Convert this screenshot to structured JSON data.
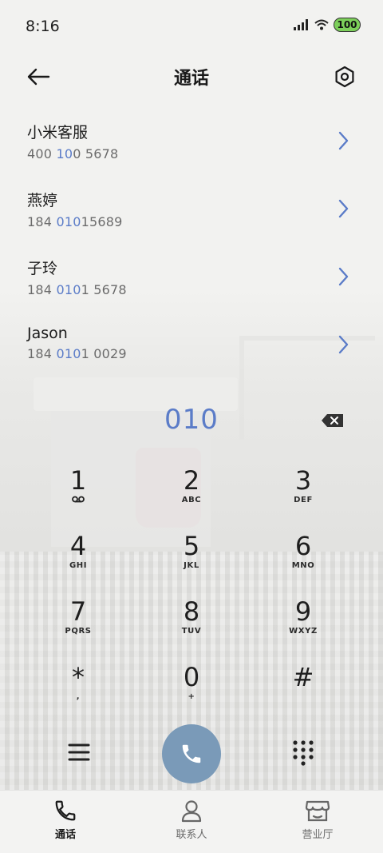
{
  "status_bar": {
    "time": "8:16",
    "battery": "100",
    "icons": [
      "signal-icon",
      "wifi-icon",
      "battery-icon"
    ]
  },
  "header": {
    "title": "通话",
    "back_icon": "arrow-left-icon",
    "settings_icon": "settings-hexagon-icon"
  },
  "results": [
    {
      "name": "小米客服",
      "num_a": "400 ",
      "num_hl1": "10",
      "num_b": "0 ",
      "num_hl2": "",
      "num_c": "5678"
    },
    {
      "name": "燕婷",
      "num_a": "184 ",
      "num_hl1": "010",
      "num_b": "15689",
      "num_hl2": "",
      "num_c": ""
    },
    {
      "name": "子玲",
      "num_a": "184 ",
      "num_hl1": "010",
      "num_b": "1 5678",
      "num_hl2": "",
      "num_c": ""
    },
    {
      "name": "Jason",
      "num_a": "184 ",
      "num_hl1": "010",
      "num_b": "1 0029",
      "num_hl2": "",
      "num_c": ""
    }
  ],
  "dialer": {
    "typed": "010",
    "keys": [
      {
        "digit": "1",
        "letters": "",
        "sub_icon": "voicemail-icon"
      },
      {
        "digit": "2",
        "letters": "ABC"
      },
      {
        "digit": "3",
        "letters": "DEF"
      },
      {
        "digit": "4",
        "letters": "GHI"
      },
      {
        "digit": "5",
        "letters": "JKL"
      },
      {
        "digit": "6",
        "letters": "MNO"
      },
      {
        "digit": "7",
        "letters": "PQRS"
      },
      {
        "digit": "8",
        "letters": "TUV"
      },
      {
        "digit": "9",
        "letters": "WXYZ"
      },
      {
        "digit": "*",
        "letters": ","
      },
      {
        "digit": "0",
        "letters": "+"
      },
      {
        "digit": "#",
        "letters": ""
      }
    ]
  },
  "tabs": [
    {
      "label": "通话",
      "icon": "phone-icon",
      "active": true
    },
    {
      "label": "联系人",
      "icon": "person-icon",
      "active": false
    },
    {
      "label": "营业厅",
      "icon": "store-icon",
      "active": false
    }
  ],
  "colors": {
    "accent": "#5b7cc8",
    "call_button": "#7a9ab8",
    "battery": "#7ccf5a"
  }
}
